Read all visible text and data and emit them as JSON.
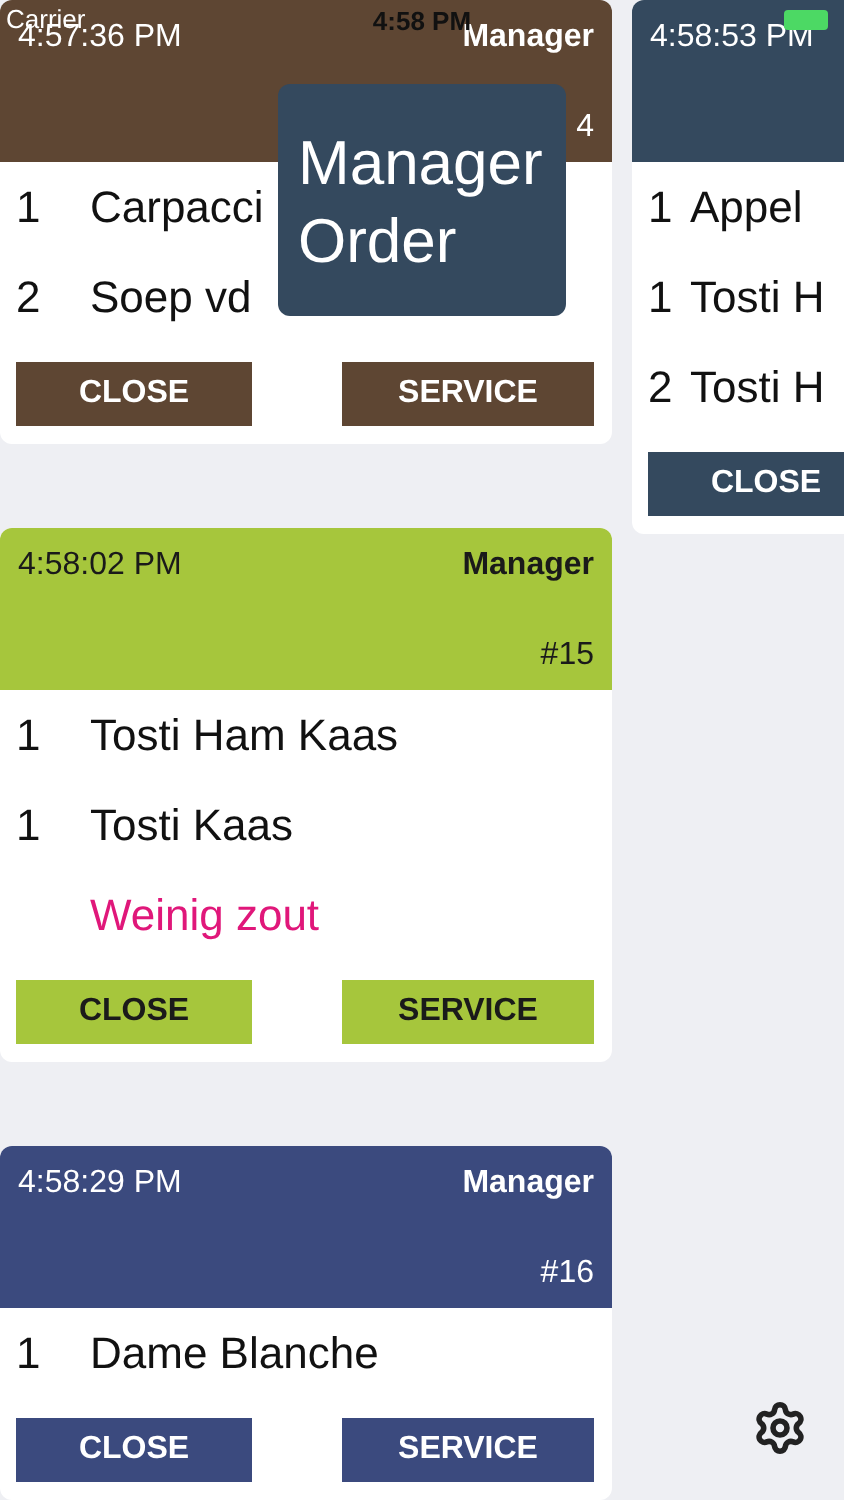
{
  "status_bar": {
    "carrier": "Carrier",
    "time": "4:58 PM"
  },
  "columns": [
    {
      "orders": [
        {
          "time": "4:57:36 PM",
          "waiter": "Manager",
          "number": "4",
          "color": "#5e4633",
          "items": [
            {
              "qty": "1",
              "name": "Carpacci"
            },
            {
              "qty": "2",
              "name": "Soep vd"
            }
          ],
          "buttons": [
            "CLOSE",
            "SERVICE"
          ]
        },
        {
          "time": "4:58:02 PM",
          "waiter": "Manager",
          "number": "#15",
          "color": "#a6c63c",
          "items": [
            {
              "qty": "1",
              "name": "Tosti Ham Kaas"
            },
            {
              "qty": "1",
              "name": "Tosti Kaas"
            }
          ],
          "note": "Weinig zout",
          "buttons": [
            "CLOSE",
            "SERVICE"
          ]
        },
        {
          "time": "4:58:29 PM",
          "waiter": "Manager",
          "number": "#16",
          "color": "#3b4a7e",
          "items": [
            {
              "qty": "1",
              "name": "Dame Blanche"
            }
          ],
          "buttons": [
            "CLOSE",
            "SERVICE"
          ]
        }
      ]
    },
    {
      "orders": [
        {
          "time": "4:58:53 PM",
          "color": "#34495e",
          "items": [
            {
              "qty": "1",
              "name": "Appel"
            },
            {
              "qty": "1",
              "name": "Tosti H"
            },
            {
              "qty": "2",
              "name": "Tosti H"
            }
          ],
          "buttons": [
            "CLOSE"
          ]
        }
      ]
    }
  ],
  "popup": {
    "text": "Manager Order"
  }
}
